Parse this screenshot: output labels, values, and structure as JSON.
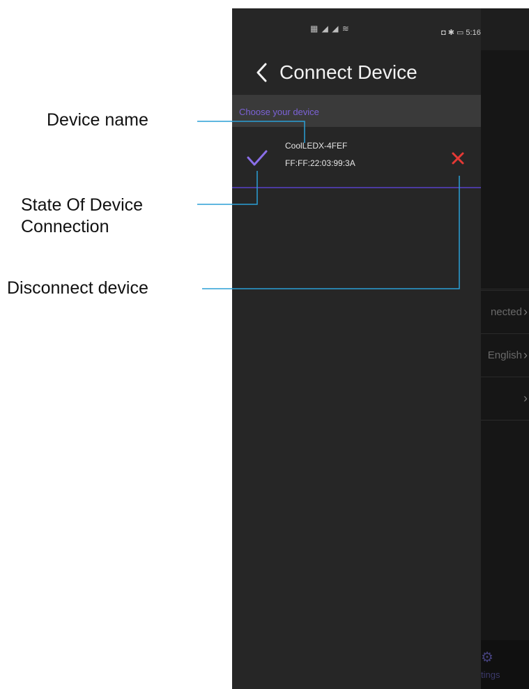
{
  "annotations": {
    "device_name": "Device name",
    "state_line1": "State Of Device",
    "state_line2": "Connection",
    "disconnect": "Disconnect device"
  },
  "status_bar": {
    "left_icons": "▦ ◢ ◢ ≋",
    "right": "◘ ✱ ▭ 5:16"
  },
  "header": {
    "title": "Connect Device"
  },
  "device_list": {
    "section_label": "Choose your device",
    "devices": [
      {
        "name": "CoolLEDX-4FEF",
        "mac": "FF:FF:22:03:99:3A",
        "connected": true
      }
    ]
  },
  "background_app": {
    "rows": [
      "nected",
      "English",
      ""
    ],
    "tab_label": "tings"
  },
  "colors": {
    "accent_purple": "#7b62d6",
    "disconnect_red": "#e53935",
    "annotation_line": "#2a9fd6"
  },
  "icons": {
    "back": "chevron-left-icon",
    "connected_state": "check-icon",
    "disconnect": "close-icon",
    "background_arrow": "chevron-right-icon",
    "settings_tab": "gear-icon"
  }
}
